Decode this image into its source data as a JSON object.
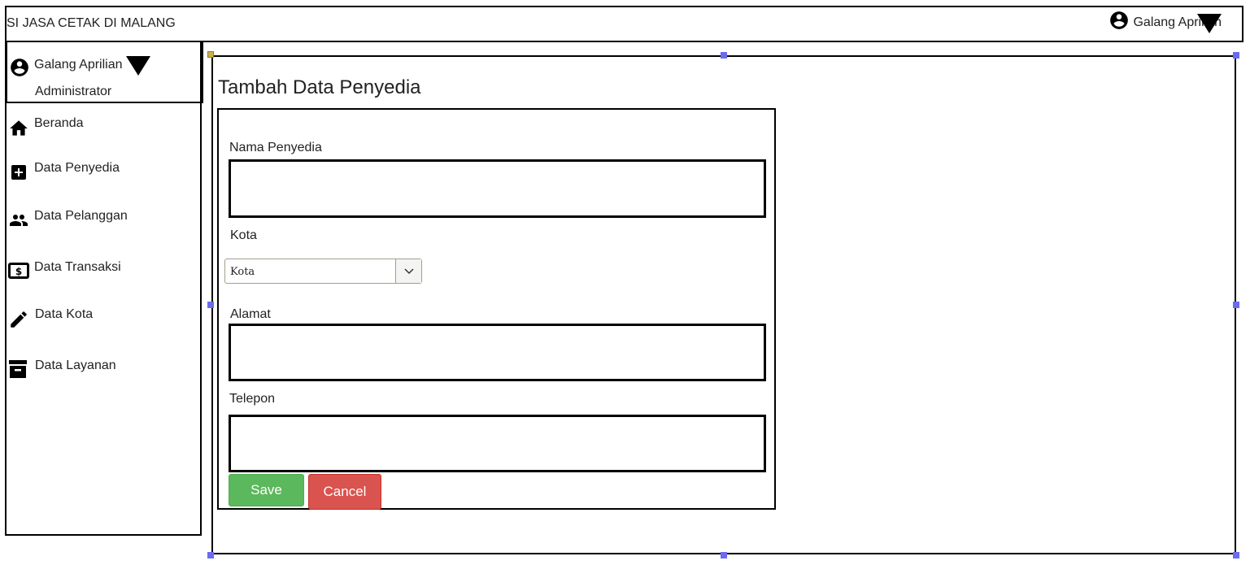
{
  "header": {
    "app_title": "SI JASA CETAK DI MALANG",
    "user_name": "Galang Aprilian"
  },
  "sidebar": {
    "user_name": "Galang Aprilian",
    "user_role": "Administrator",
    "items": [
      {
        "label": "Beranda",
        "icon": "home-icon"
      },
      {
        "label": "Data Penyedia",
        "icon": "add-box-icon"
      },
      {
        "label": "Data Pelanggan",
        "icon": "people-icon"
      },
      {
        "label": "Data Transaksi",
        "icon": "money-icon"
      },
      {
        "label": "Data Kota",
        "icon": "pencil-icon"
      },
      {
        "label": "Data Layanan",
        "icon": "archive-icon"
      }
    ]
  },
  "form": {
    "title": "Tambah Data Penyedia",
    "nama_label": "Nama Penyedia",
    "nama_value": "",
    "kota_label": "Kota",
    "kota_selected": "Kota",
    "alamat_label": "Alamat",
    "alamat_value": "",
    "telepon_label": "Telepon",
    "telepon_value": "",
    "save_label": "Save",
    "cancel_label": "Cancel"
  },
  "colors": {
    "save": "#5cb85c",
    "cancel": "#d9534f",
    "selection_handle": "#6b6bf0"
  }
}
